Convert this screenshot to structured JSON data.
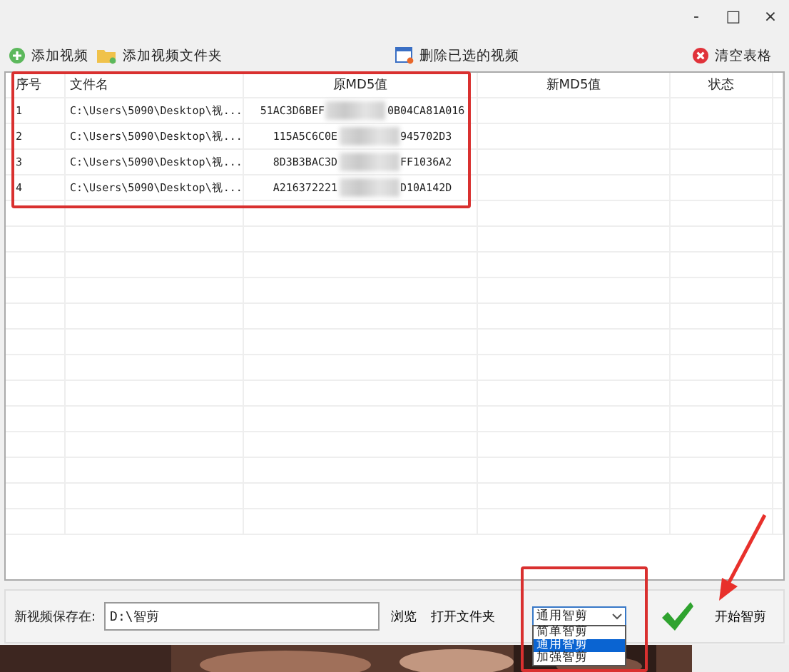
{
  "window": {
    "controls": [
      "-",
      "□",
      "×"
    ]
  },
  "toolbar": [
    {
      "label": "添加视频",
      "kind": "add"
    },
    {
      "label": "添加视频文件夹",
      "kind": "folder"
    },
    {
      "label": "删除已选的视频",
      "kind": "delete"
    },
    {
      "label": "清空表格",
      "kind": "clear"
    }
  ],
  "table": {
    "columns": [
      "序号",
      "文件名",
      "原MD5值",
      "新MD5值",
      "状态"
    ],
    "rows": [
      {
        "index": "1",
        "file": "C:\\Users\\5090\\Desktop\\视...",
        "md5_start": "51AC3D6BEF",
        "md5_end": "0B04CA81A016"
      },
      {
        "index": "2",
        "file": "C:\\Users\\5090\\Desktop\\视...",
        "md5_start": "115A5C6C0E",
        "md5_end": "945702D3"
      },
      {
        "index": "3",
        "file": "C:\\Users\\5090\\Desktop\\视...",
        "md5_start": "8D3B3BAC3D",
        "md5_end": "FF1036A2"
      },
      {
        "index": "4",
        "file": "C:\\Users\\5090\\Desktop\\视...",
        "md5_start": "A216372221",
        "md5_end": "D10A142D"
      }
    ]
  },
  "bottom": {
    "save_label": "新视频保存在:",
    "save_path": "D:\\智剪",
    "browse": "浏览",
    "open_folder": "打开文件夹",
    "mode": {
      "value": "通用智剪",
      "options": [
        {
          "label": "简单智剪",
          "selected": false
        },
        {
          "label": "通用智剪",
          "selected": true
        },
        {
          "label": "加强智剪",
          "selected": false
        }
      ]
    },
    "start": "开始智剪"
  }
}
